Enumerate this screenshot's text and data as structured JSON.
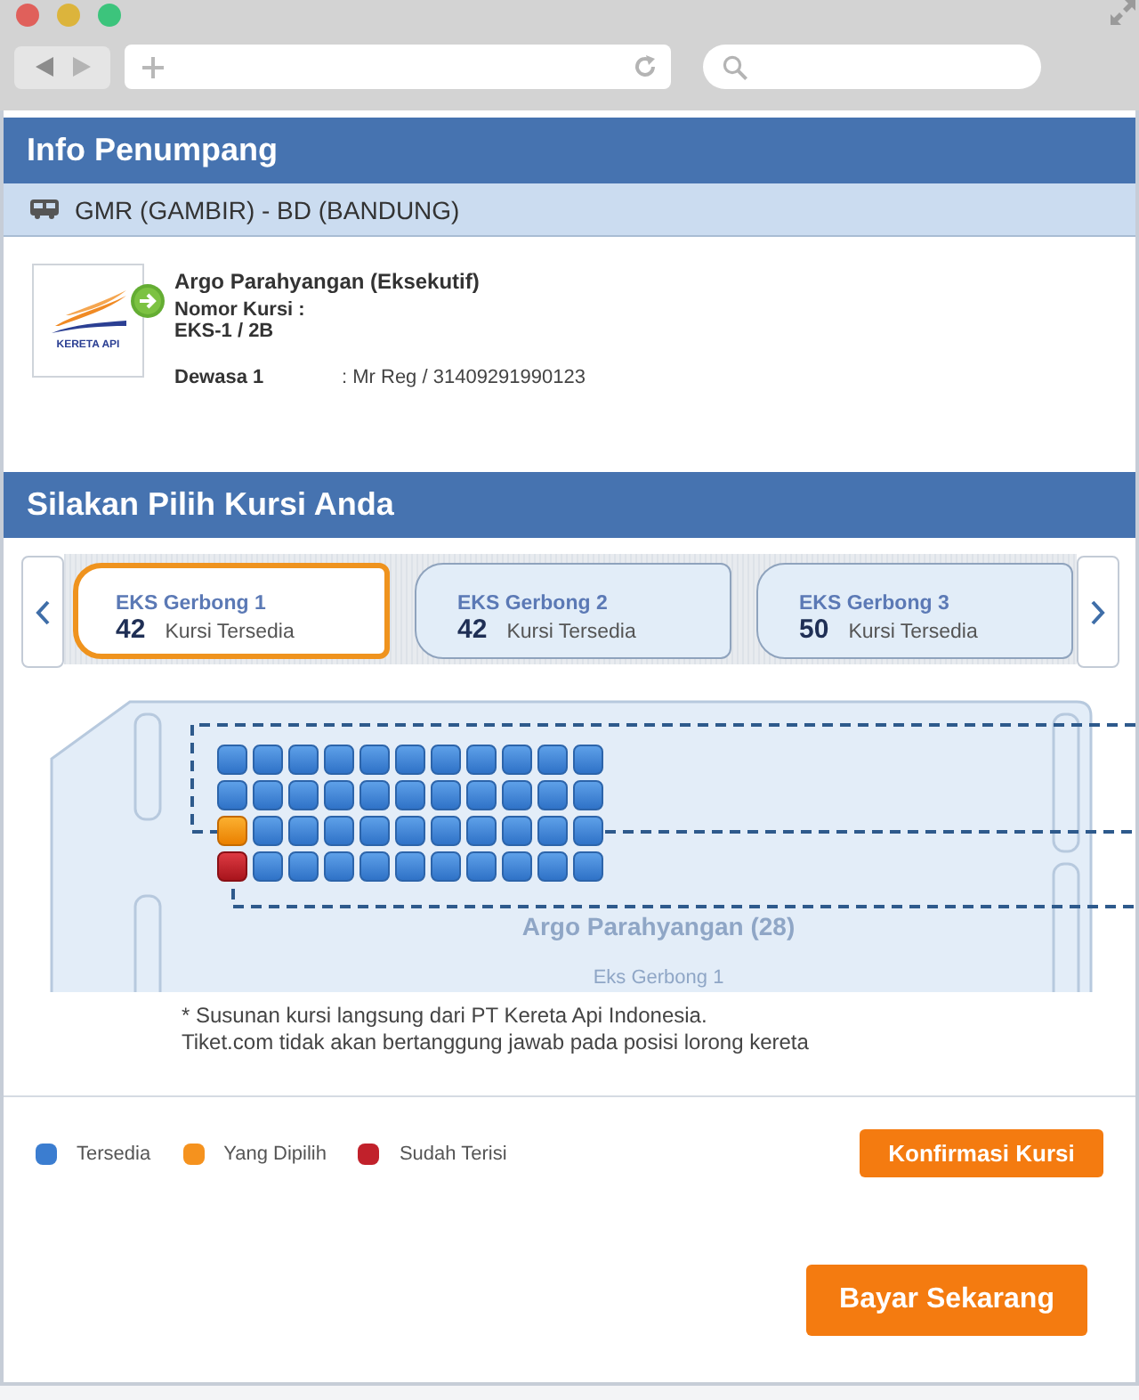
{
  "passenger_info": {
    "title": "Info Penumpang",
    "route": "GMR (GAMBIR) - BD (BANDUNG)",
    "logo_text": "KERETA API",
    "train": "Argo Parahyangan (Eksekutif)",
    "seat_label": "Nomor Kursi :",
    "seat": "EKS-1 / 2B",
    "passenger_type": "Dewasa 1",
    "passenger": ": Mr Reg / 31409291990123"
  },
  "seat_selection": {
    "title": "Silakan Pilih Kursi Anda",
    "cars": [
      {
        "label": "EKS Gerbong 1",
        "count": "42",
        "count_label": "Kursi Tersedia",
        "selected": true
      },
      {
        "label": "EKS Gerbong 2",
        "count": "42",
        "count_label": "Kursi Tersedia",
        "selected": false
      },
      {
        "label": "EKS Gerbong 3",
        "count": "50",
        "count_label": "Kursi Tersedia",
        "selected": false
      }
    ],
    "seat_map": {
      "train": "Argo Parahyangan (28)",
      "car": "Eks Gerbong 1",
      "rows": [
        {
          "seats": [
            {
              "selected": false,
              "occupied": false
            },
            {
              "selected": false,
              "occupied": false
            },
            {
              "selected": false,
              "occupied": false
            },
            {
              "selected": false,
              "occupied": false
            },
            {
              "selected": false,
              "occupied": false
            },
            {
              "selected": false,
              "occupied": false
            },
            {
              "selected": false,
              "occupied": false
            },
            {
              "selected": false,
              "occupied": false
            },
            {
              "selected": false,
              "occupied": false
            },
            {
              "selected": false,
              "occupied": false
            },
            {
              "selected": false,
              "occupied": false
            }
          ]
        },
        {
          "seats": [
            {
              "selected": false,
              "occupied": false
            },
            {
              "selected": false,
              "occupied": false
            },
            {
              "selected": false,
              "occupied": false
            },
            {
              "selected": false,
              "occupied": false
            },
            {
              "selected": false,
              "occupied": false
            },
            {
              "selected": false,
              "occupied": false
            },
            {
              "selected": false,
              "occupied": false
            },
            {
              "selected": false,
              "occupied": false
            },
            {
              "selected": false,
              "occupied": false
            },
            {
              "selected": false,
              "occupied": false
            },
            {
              "selected": false,
              "occupied": false
            }
          ]
        },
        {
          "seats": [
            {
              "selected": true,
              "occupied": false
            },
            {
              "selected": false,
              "occupied": false
            },
            {
              "selected": false,
              "occupied": false
            },
            {
              "selected": false,
              "occupied": false
            },
            {
              "selected": false,
              "occupied": false
            },
            {
              "selected": false,
              "occupied": false
            },
            {
              "selected": false,
              "occupied": false
            },
            {
              "selected": false,
              "occupied": false
            },
            {
              "selected": false,
              "occupied": false
            },
            {
              "selected": false,
              "occupied": false
            },
            {
              "selected": false,
              "occupied": false
            }
          ]
        },
        {
          "seats": [
            {
              "selected": false,
              "occupied": true
            },
            {
              "selected": false,
              "occupied": false
            },
            {
              "selected": false,
              "occupied": false
            },
            {
              "selected": false,
              "occupied": false
            },
            {
              "selected": false,
              "occupied": false
            },
            {
              "selected": false,
              "occupied": false
            },
            {
              "selected": false,
              "occupied": false
            },
            {
              "selected": false,
              "occupied": false
            },
            {
              "selected": false,
              "occupied": false
            },
            {
              "selected": false,
              "occupied": false
            },
            {
              "selected": false,
              "occupied": false
            }
          ]
        }
      ]
    },
    "note": [
      "* Susunan kursi langsung dari PT Kereta Api Indonesia.",
      "Tiket.com tidak akan bertanggung jawab pada posisi lorong kereta"
    ],
    "legend": [
      {
        "label": "Tersedia",
        "color": "#3b7dd0"
      },
      {
        "label": "Yang Dipilih",
        "color": "#f5921e"
      },
      {
        "label": "Sudah Terisi",
        "color": "#c1212b"
      }
    ],
    "confirm_button": "Konfirmasi Kursi"
  },
  "pay_button": "Bayar Sekarang"
}
